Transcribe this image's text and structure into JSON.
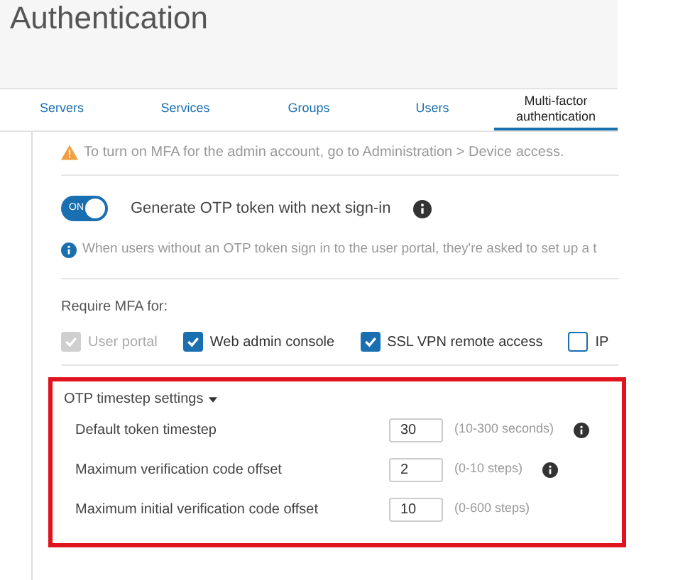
{
  "header": {
    "title": "Authentication"
  },
  "tabs": [
    {
      "label": "Servers",
      "selected": false
    },
    {
      "label": "Services",
      "selected": false
    },
    {
      "label": "Groups",
      "selected": false
    },
    {
      "label": "Users",
      "selected": false
    },
    {
      "label": "Multi-factor authentication",
      "selected": true
    }
  ],
  "warning": "To turn on MFA for the admin account, go to Administration > Device access.",
  "otp_toggle": {
    "state_label": "ON",
    "on": true,
    "label": "Generate OTP token with next sign-in"
  },
  "info_note": "When users without an OTP token sign in to the user portal, they're asked to set up a t",
  "require_mfa": {
    "label": "Require MFA for:",
    "options": [
      {
        "label": "User portal",
        "checked": true,
        "disabled": true
      },
      {
        "label": "Web admin console",
        "checked": true,
        "disabled": false
      },
      {
        "label": "SSL VPN remote access",
        "checked": true,
        "disabled": false
      },
      {
        "label": "IP",
        "checked": false,
        "disabled": false
      }
    ]
  },
  "otp_timestep": {
    "title": "OTP timestep settings",
    "expanded": true,
    "rows": [
      {
        "label": "Default token timestep",
        "value": "30",
        "range": "(10-300 seconds)",
        "info": true
      },
      {
        "label": "Maximum verification code offset",
        "value": "2",
        "range": "(0-10 steps)",
        "info": true
      },
      {
        "label": "Maximum initial verification code offset",
        "value": "10",
        "range": "(0-600 steps)",
        "info": false
      }
    ]
  }
}
